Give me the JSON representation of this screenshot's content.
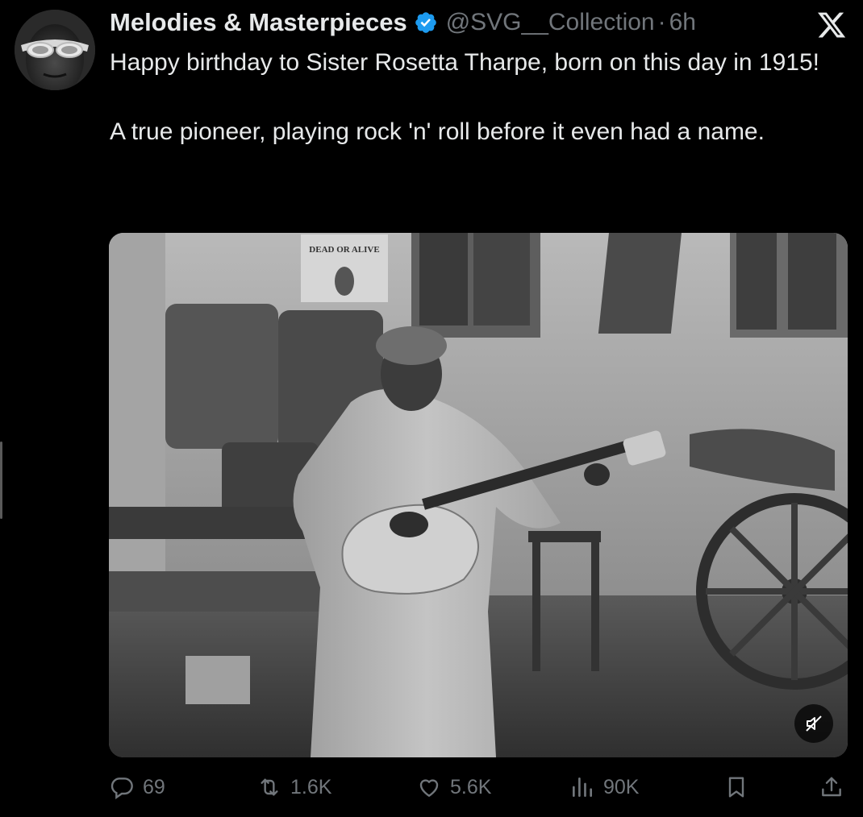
{
  "tweet": {
    "display_name": "Melodies & Masterpieces",
    "handle": "@SVG__Collection",
    "separator": "·",
    "time": "6h",
    "paragraphs": [
      "Happy birthday to Sister Rosetta Tharpe, born on this day in 1915!",
      "A true pioneer, playing rock 'n' roll before it even had a name."
    ]
  },
  "media": {
    "sign_text": "DEAD OR ALIVE"
  },
  "stats": {
    "replies": "69",
    "reposts": "1.6K",
    "likes": "5.6K",
    "views": "90K"
  },
  "colors": {
    "background": "#000000",
    "text_primary": "#e7e9ea",
    "text_secondary": "#71767b",
    "verified_blue": "#1d9bf0"
  },
  "icons": {
    "verified": "verified-badge-icon",
    "close": "x-logo-icon",
    "reply": "comment-icon",
    "repost": "repost-icon",
    "like": "heart-icon",
    "views": "views-chart-icon",
    "bookmark": "bookmark-icon",
    "share": "share-icon",
    "mute": "muted-speaker-icon"
  }
}
